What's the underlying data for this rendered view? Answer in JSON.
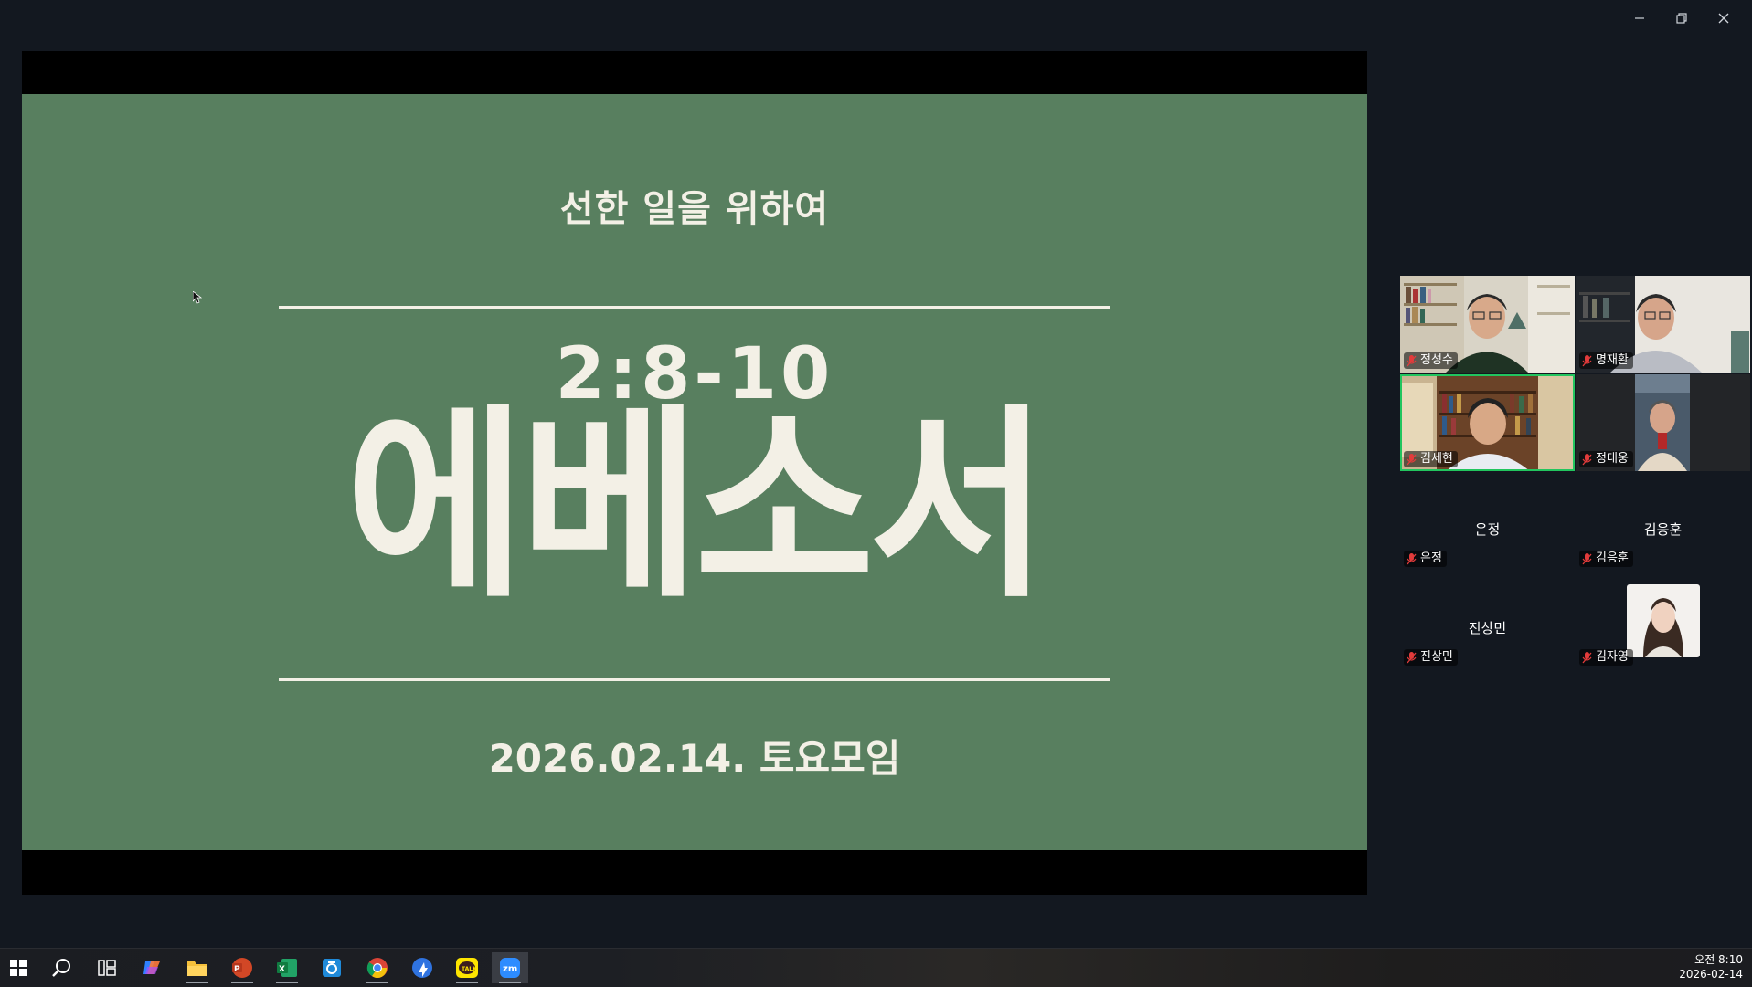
{
  "window": {
    "controls": {
      "minimize": "minimize-icon",
      "restore": "restore-icon",
      "close": "close-icon"
    }
  },
  "slide": {
    "subtitle": "선한 일을 위하여",
    "reference": "2:8-10",
    "title": "에베소서",
    "date": "2026.02.14. 토요모임",
    "background": "#587f5f",
    "text_color": "#f3f0e6"
  },
  "participants": {
    "video_tiles": [
      {
        "name": "정성수",
        "muted": true
      },
      {
        "name": "명재환",
        "muted": true
      },
      {
        "name": "김세현",
        "muted": true,
        "active_speaker": true
      },
      {
        "name": "정대웅",
        "muted": true
      }
    ],
    "audio_tiles": [
      {
        "display": "은정",
        "name": "은정",
        "muted": true
      },
      {
        "display": "김응훈",
        "name": "김응훈",
        "muted": true
      },
      {
        "display": "진상민",
        "name": "진상민",
        "muted": true
      },
      {
        "display": "",
        "name": "김자영",
        "muted": true,
        "has_photo": true
      }
    ],
    "active_color": "#22c55e"
  },
  "taskbar": {
    "apps": [
      "start-icon",
      "search-icon",
      "task-view-icon",
      "copilot-icon",
      "file-explorer-icon",
      "powerpoint-icon",
      "excel-icon",
      "hwp-icon",
      "chrome-icon",
      "app-icon",
      "kakaotalk-icon",
      "zoom-icon"
    ],
    "clock": {
      "time": "오전 8:10",
      "date": "2026-02-14"
    }
  }
}
